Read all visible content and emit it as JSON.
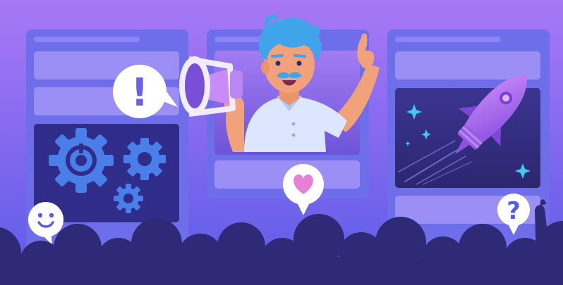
{
  "speech_bubbles": {
    "alert_symbol": "!",
    "question_symbol": "?"
  },
  "icons": [
    "exclamation-icon",
    "megaphone-icon",
    "heart-icon",
    "smiley-icon",
    "question-icon",
    "gear-icon",
    "rocket-icon",
    "sparkle-icon"
  ],
  "colors": {
    "sky_top": "#a774f4",
    "sky_bottom": "#5b5fe9",
    "board": "#6c6ee8",
    "card": "#8f8cf6",
    "crowd": "#2e2a78",
    "gear": "#4a7de9",
    "rocket": "#b06cf0",
    "heart": "#e880d8",
    "skin": "#f2a27a",
    "hair": "#3fa4ea",
    "shirt": "#dde8ff"
  }
}
